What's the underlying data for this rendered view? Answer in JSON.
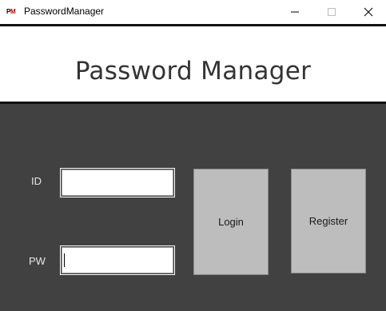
{
  "window": {
    "icon_text_a": "P",
    "icon_text_b": "M",
    "title": "PasswordManager",
    "minimize_icon": "minimize-icon",
    "maximize_icon": "maximize-icon",
    "close_icon": "close-icon"
  },
  "header": {
    "title": "Password Manager"
  },
  "form": {
    "id_label": "ID",
    "id_value": "",
    "pw_label": "PW",
    "pw_value": ""
  },
  "buttons": {
    "login_label": "Login",
    "register_label": "Register"
  },
  "colors": {
    "main_background": "#414141",
    "button_background": "#bdbdbd",
    "header_text": "#333333"
  }
}
